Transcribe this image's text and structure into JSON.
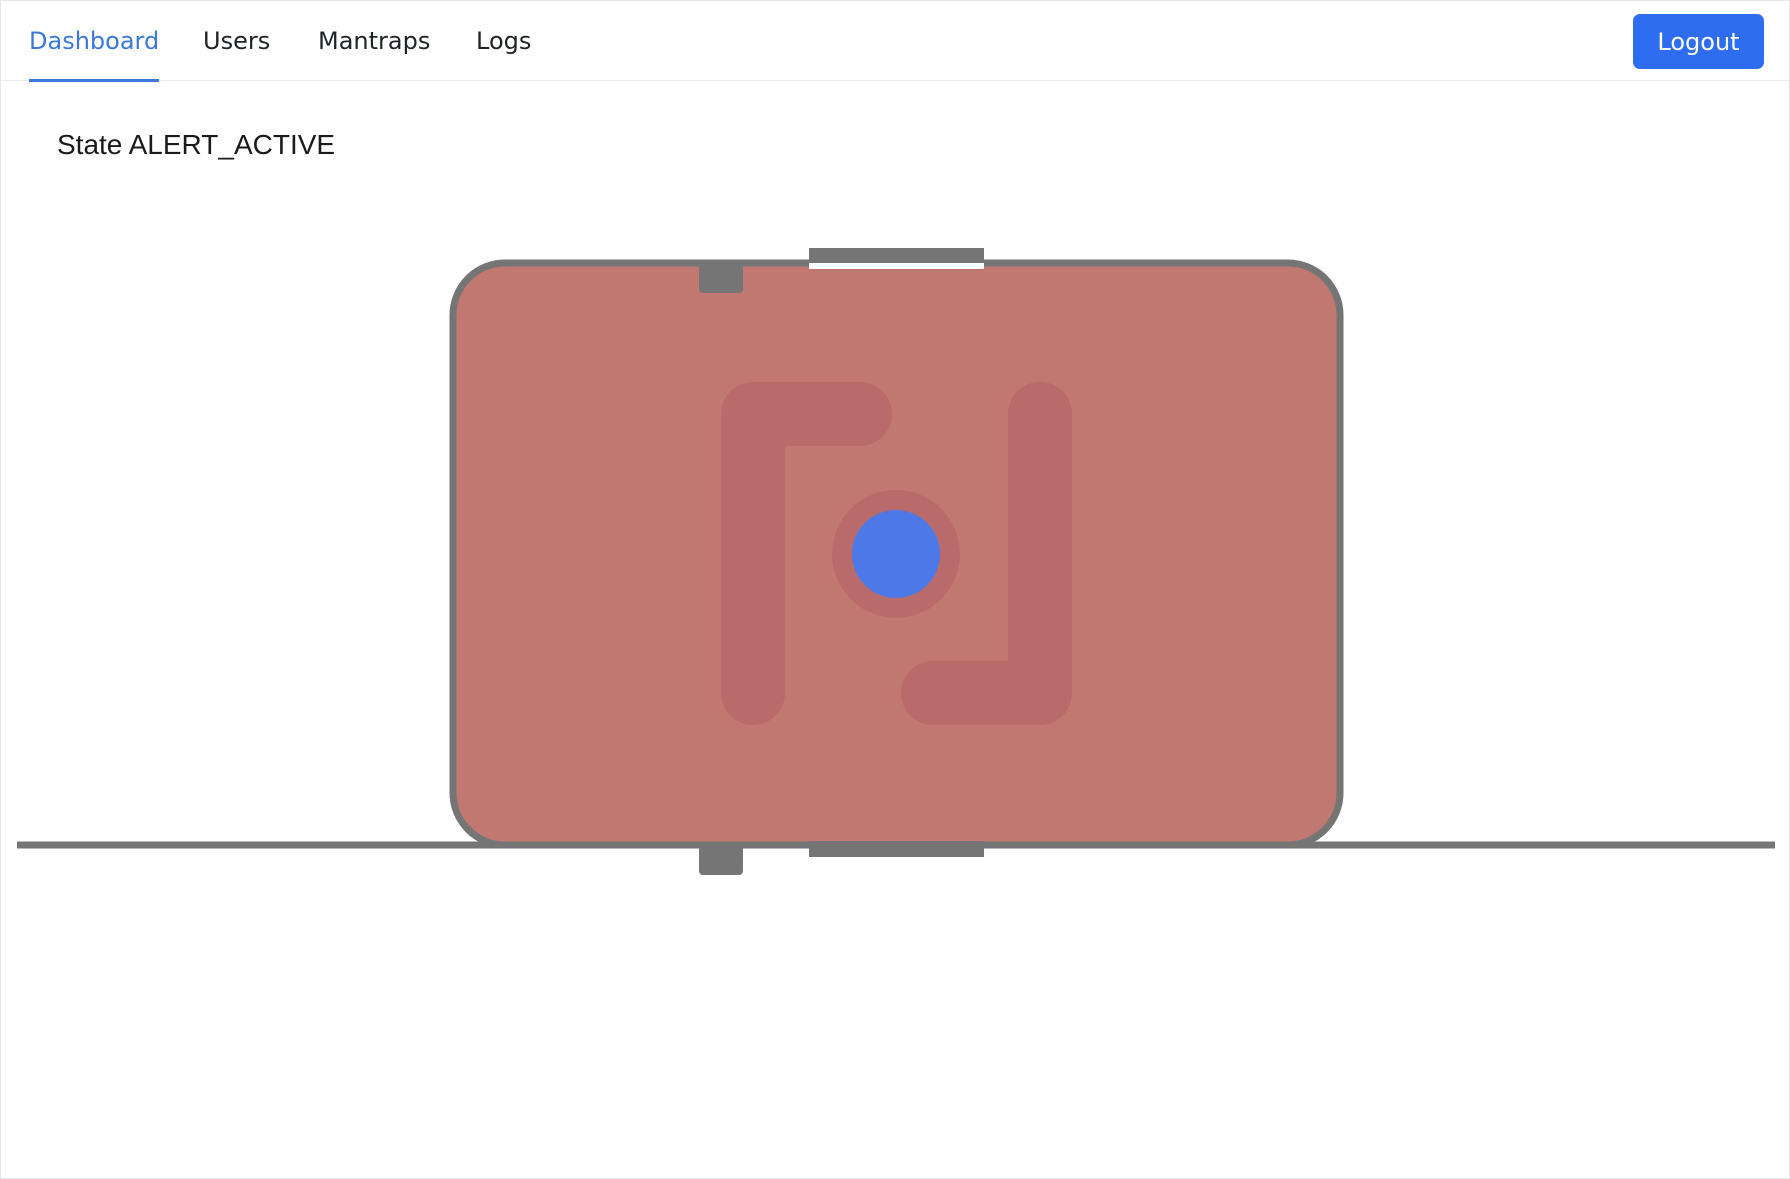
{
  "nav": {
    "tabs": [
      {
        "label": "Dashboard",
        "active": true
      },
      {
        "label": "Users",
        "active": false
      },
      {
        "label": "Mantraps",
        "active": false
      },
      {
        "label": "Logs",
        "active": false
      }
    ],
    "logout_label": "Logout"
  },
  "status": {
    "label": "State",
    "value": "ALERT_ACTIVE"
  },
  "colors": {
    "accent": "#3c78d8",
    "logout_button": "#2f6df0",
    "room_fill_alert": "#c17870",
    "wall": "#757575",
    "occupant_dot": "#4d79e8"
  },
  "icons": {
    "occupant": "person-dot-icon",
    "room_marker": "bracket-marker-icon"
  }
}
